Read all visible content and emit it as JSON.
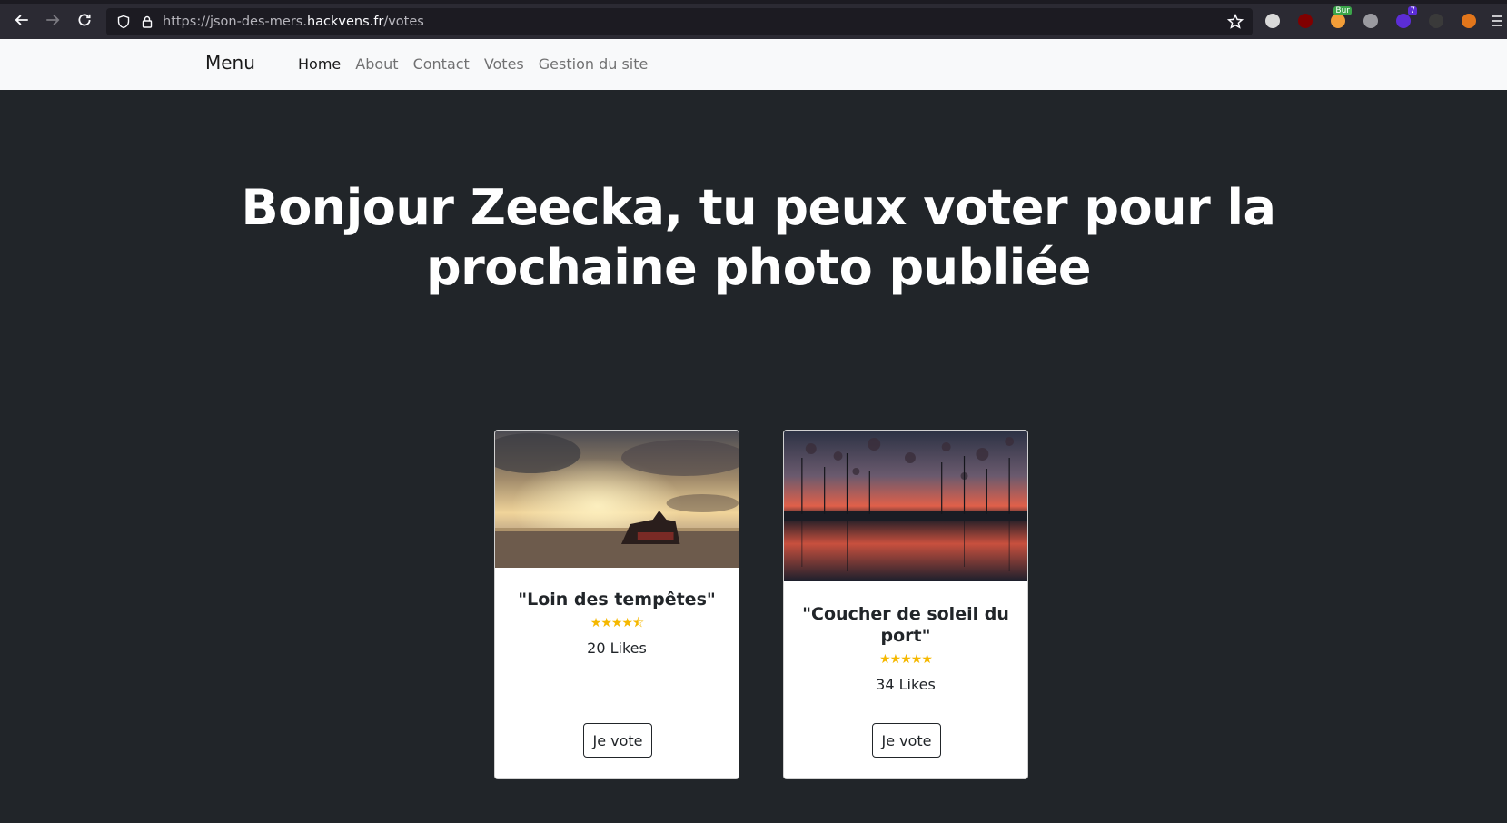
{
  "browser": {
    "url_prefix": "https://json-des-mers.",
    "url_host": "hackvens.fr",
    "url_path": "/votes",
    "extensions": [
      {
        "icon": "mask-icon",
        "color": "#d9d9d9",
        "badge": ""
      },
      {
        "icon": "ublock-icon",
        "color": "#800000",
        "badge": ""
      },
      {
        "icon": "burp-icon",
        "color": "#f29d38",
        "badge": "Bur"
      },
      {
        "icon": "diamond-icon",
        "color": "#9a9aa0",
        "badge": ""
      },
      {
        "icon": "puzzle-icon",
        "color": "#5c2dd6",
        "badge": "7"
      },
      {
        "icon": "hat-icon",
        "color": "#3a3a3a",
        "badge": ""
      },
      {
        "icon": "fox-icon",
        "color": "#e2761b",
        "badge": ""
      }
    ]
  },
  "nav": {
    "brand": "Menu",
    "links": [
      "Home",
      "About",
      "Contact",
      "Votes",
      "Gestion du site"
    ]
  },
  "hero": {
    "title": "Bonjour Zeecka, tu peux voter pour la prochaine photo publiée"
  },
  "cards": [
    {
      "title": "\"Loin des tempêtes\"",
      "rating": 4.5,
      "stars": "★★★★⯪",
      "likes": "20 Likes",
      "button": "Je vote"
    },
    {
      "title": "\"Coucher de soleil du port\"",
      "rating": 5,
      "stars": "★★★★★",
      "likes": "34 Likes",
      "button": "Je vote"
    }
  ],
  "colors": {
    "page_bg": "#212529",
    "navbar_bg": "#f8f9fa",
    "star": "#f5b800"
  }
}
